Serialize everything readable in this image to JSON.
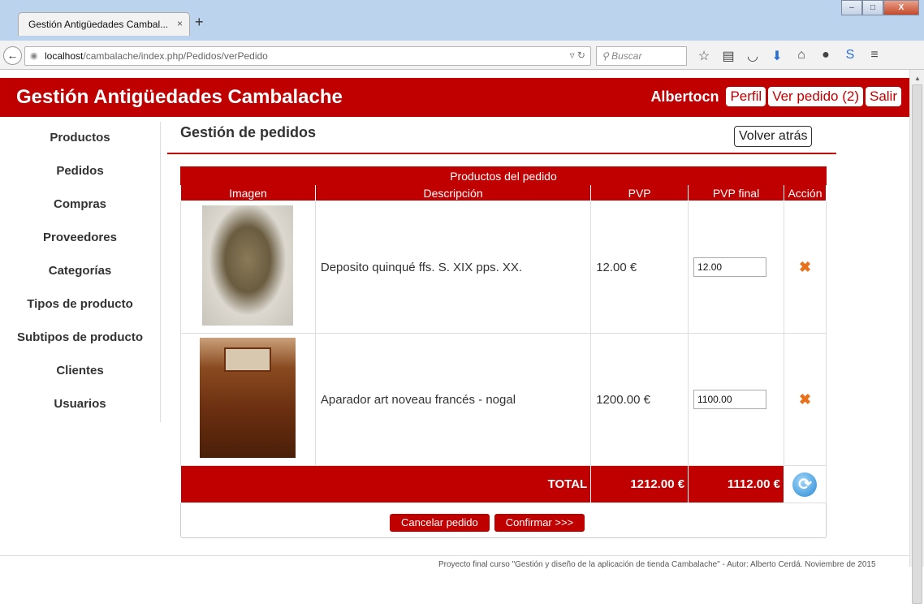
{
  "browser": {
    "tab_title": "Gestión Antigüedades Cambal...",
    "tab_close": "×",
    "new_tab": "+",
    "url_host": "localhost",
    "url_path": "/cambalache/index.php/Pedidos/verPedido",
    "search_placeholder": "Buscar",
    "window_buttons": [
      "–",
      "□",
      "X"
    ],
    "toolbar_icons": [
      "star-icon",
      "reading-list-icon",
      "pocket-icon",
      "download-icon",
      "home-icon",
      "chat-icon",
      "sync-icon",
      "menu-icon"
    ]
  },
  "header": {
    "title": "Gestión Antigüedades Cambalache",
    "username": "Albertocn",
    "profile_label": "Perfil",
    "order_label": "Ver pedido (2)",
    "logout_label": "Salir"
  },
  "sidebar": {
    "items": [
      {
        "label": "Productos"
      },
      {
        "label": "Pedidos"
      },
      {
        "label": "Compras"
      },
      {
        "label": "Proveedores"
      },
      {
        "label": "Categorías"
      },
      {
        "label": "Tipos de producto"
      },
      {
        "label": "Subtipos de producto"
      },
      {
        "label": "Clientes"
      },
      {
        "label": "Usuarios"
      }
    ]
  },
  "main": {
    "title": "Gestión de pedidos",
    "back_label": "Volver atrás",
    "table": {
      "caption": "Productos del pedido",
      "columns": [
        "Imagen",
        "Descripción",
        "PVP",
        "PVP final",
        "Acción"
      ],
      "rows": [
        {
          "description": "Deposito quinqué ffs. S. XIX pps. XX.",
          "pvp": "12.00 €",
          "pvp_final": "12.00",
          "image": "vase"
        },
        {
          "description": "Aparador art noveau francés - nogal",
          "pvp": "1200.00 €",
          "pvp_final": "1100.00",
          "image": "dresser"
        }
      ],
      "total_label": "TOTAL",
      "total_pvp": "1212.00 €",
      "total_final": "1112.00 €"
    },
    "cancel_label": "Cancelar pedido",
    "confirm_label": "Confirmar >>>"
  },
  "footer": {
    "text": "Proyecto final curso \"Gestión y diseño de la aplicación de tienda Cambalache\" - Autor: Alberto Cerdá. Noviembre de 2015"
  },
  "colors": {
    "brand": "#c00000",
    "delete_icon": "#e8711a"
  }
}
